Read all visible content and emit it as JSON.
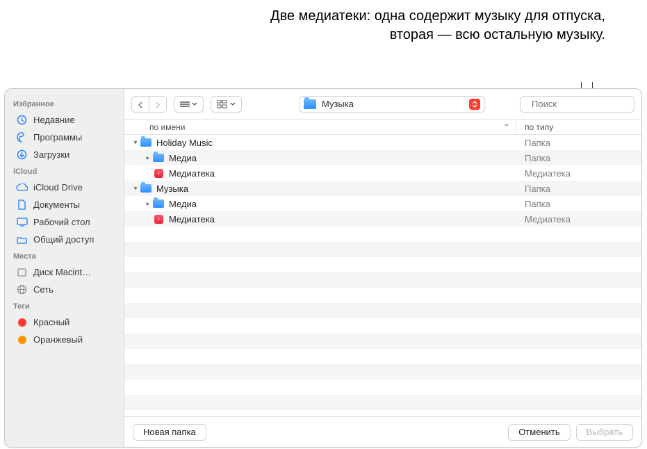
{
  "annotation": "Две медиатеки: одна содержит музыку для отпуска, вторая — всю остальную музыку.",
  "sidebar": {
    "sections": [
      {
        "title": "Избранное",
        "items": [
          {
            "id": "recent",
            "label": "Недавние",
            "icon": "clock"
          },
          {
            "id": "apps",
            "label": "Программы",
            "icon": "apps"
          },
          {
            "id": "downloads",
            "label": "Загрузки",
            "icon": "download"
          }
        ]
      },
      {
        "title": "iCloud",
        "items": [
          {
            "id": "iclouddrive",
            "label": "iCloud Drive",
            "icon": "cloud"
          },
          {
            "id": "documents",
            "label": "Документы",
            "icon": "doc"
          },
          {
            "id": "desktop",
            "label": "Рабочий стол",
            "icon": "desktop"
          },
          {
            "id": "shared",
            "label": "Общий доступ",
            "icon": "shared"
          }
        ]
      },
      {
        "title": "Места",
        "items": [
          {
            "id": "macdisk",
            "label": "Диск Macint…",
            "icon": "disk"
          },
          {
            "id": "network",
            "label": "Сеть",
            "icon": "globe"
          }
        ]
      },
      {
        "title": "Теги",
        "items": [
          {
            "id": "tag-red",
            "label": "Красный",
            "icon": "dot",
            "color": "#ff3b30"
          },
          {
            "id": "tag-orange",
            "label": "Оранжевый",
            "icon": "dot",
            "color": "#ff9500"
          }
        ]
      }
    ]
  },
  "toolbar": {
    "path_label": "Музыка",
    "search_placeholder": "Поиск"
  },
  "columns": {
    "name_label": "по имени",
    "type_label": "по типу"
  },
  "files": [
    {
      "indent": 0,
      "disclosure": "open",
      "icon": "folder",
      "name": "Holiday Music",
      "type": "Папка"
    },
    {
      "indent": 1,
      "disclosure": "closed",
      "icon": "folder",
      "name": "Медиа",
      "type": "Папка"
    },
    {
      "indent": 1,
      "disclosure": "",
      "icon": "library",
      "name": "Медиатека",
      "type": "Медиатека"
    },
    {
      "indent": 0,
      "disclosure": "open",
      "icon": "folder",
      "name": "Музыка",
      "type": "Папка"
    },
    {
      "indent": 1,
      "disclosure": "closed",
      "icon": "folder",
      "name": "Медиа",
      "type": "Папка"
    },
    {
      "indent": 1,
      "disclosure": "",
      "icon": "library",
      "name": "Медиатека",
      "type": "Медиатека"
    }
  ],
  "footer": {
    "new_folder": "Новая папка",
    "cancel": "Отменить",
    "choose": "Выбрать"
  }
}
